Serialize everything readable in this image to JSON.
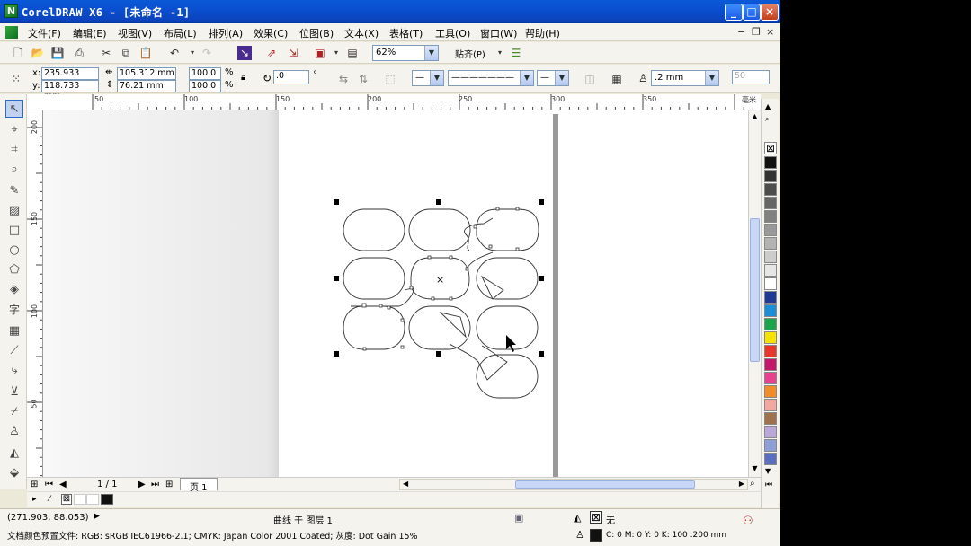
{
  "window": {
    "title": "CorelDRAW X6 - [未命名 -1]"
  },
  "menu": [
    "文件(F)",
    "编辑(E)",
    "视图(V)",
    "布局(L)",
    "排列(A)",
    "效果(C)",
    "位图(B)",
    "文本(X)",
    "表格(T)",
    "工具(O)",
    "窗口(W)",
    "帮助(H)"
  ],
  "toolbar": {
    "zoom": "62%",
    "snap_label": "贴齐(P)"
  },
  "props": {
    "x_label": "x:",
    "x_value": "235.933 mm",
    "y_label": "y:",
    "y_value": "118.733 mm",
    "w_value": "105.312 mm",
    "h_value": "76.21 mm",
    "scale_w": "100.0",
    "scale_h": "100.0",
    "pct": "%",
    "angle": ".0",
    "deg": "°",
    "outline_width": ".2 mm",
    "misc_value": "50"
  },
  "ruler_h": [
    "50",
    "100",
    "150",
    "200",
    "250",
    "300",
    "350",
    "毫米"
  ],
  "ruler_v": [
    "200",
    "150",
    "100",
    "50"
  ],
  "page_nav": {
    "counter": "1 / 1",
    "tab": "页 1"
  },
  "status": {
    "coords": "(271.903, 88.053)",
    "object": "曲线 于 图层 1",
    "fill_none": "无",
    "outline_info": "C: 0 M: 0 Y: 0 K: 100  .200 mm",
    "color_profile": "文档颜色预置文件: RGB: sRGB IEC61966-2.1; CMYK: Japan Color 2001 Coated; 灰度: Dot Gain 15%"
  },
  "palette_colors": [
    "#111111",
    "#333333",
    "#4d4d4d",
    "#666666",
    "#808080",
    "#999999",
    "#b3b3b3",
    "#cccccc",
    "#e6e6e6",
    "#ffffff",
    "#1f3a93",
    "#1a8fd6",
    "#19a64b",
    "#f5e400",
    "#e8372a",
    "#c4176b",
    "#e94190",
    "#f28c28",
    "#f4a6a0",
    "#a0724b",
    "#b9a8d8",
    "#8ba0d6",
    "#5a6ec2"
  ]
}
